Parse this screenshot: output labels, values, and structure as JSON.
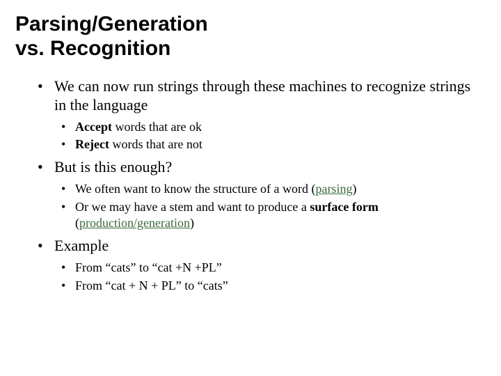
{
  "title_l1": "Parsing/Generation",
  "title_l2": "vs. Recognition",
  "b1": {
    "text": "We can now run strings through these machines to recognize strings in the language",
    "sub": [
      {
        "bold": "Accept",
        "rest": " words that are ok"
      },
      {
        "bold": "Reject",
        "rest": " words that are not"
      }
    ]
  },
  "b2": {
    "text": "But is this enough?",
    "sub1_pre": "We often want to know the structure of a word (",
    "sub1_term": "parsing",
    "sub1_post": ")",
    "sub2_pre": "Or we may have a stem and want to produce a ",
    "sub2_bold": "surface form",
    "sub2_mid": " (",
    "sub2_term": "production/generation",
    "sub2_post": ")"
  },
  "b3": {
    "text": "Example",
    "sub": [
      "From “cats” to “cat +N +PL”",
      "From “cat + N + PL” to “cats”"
    ]
  }
}
